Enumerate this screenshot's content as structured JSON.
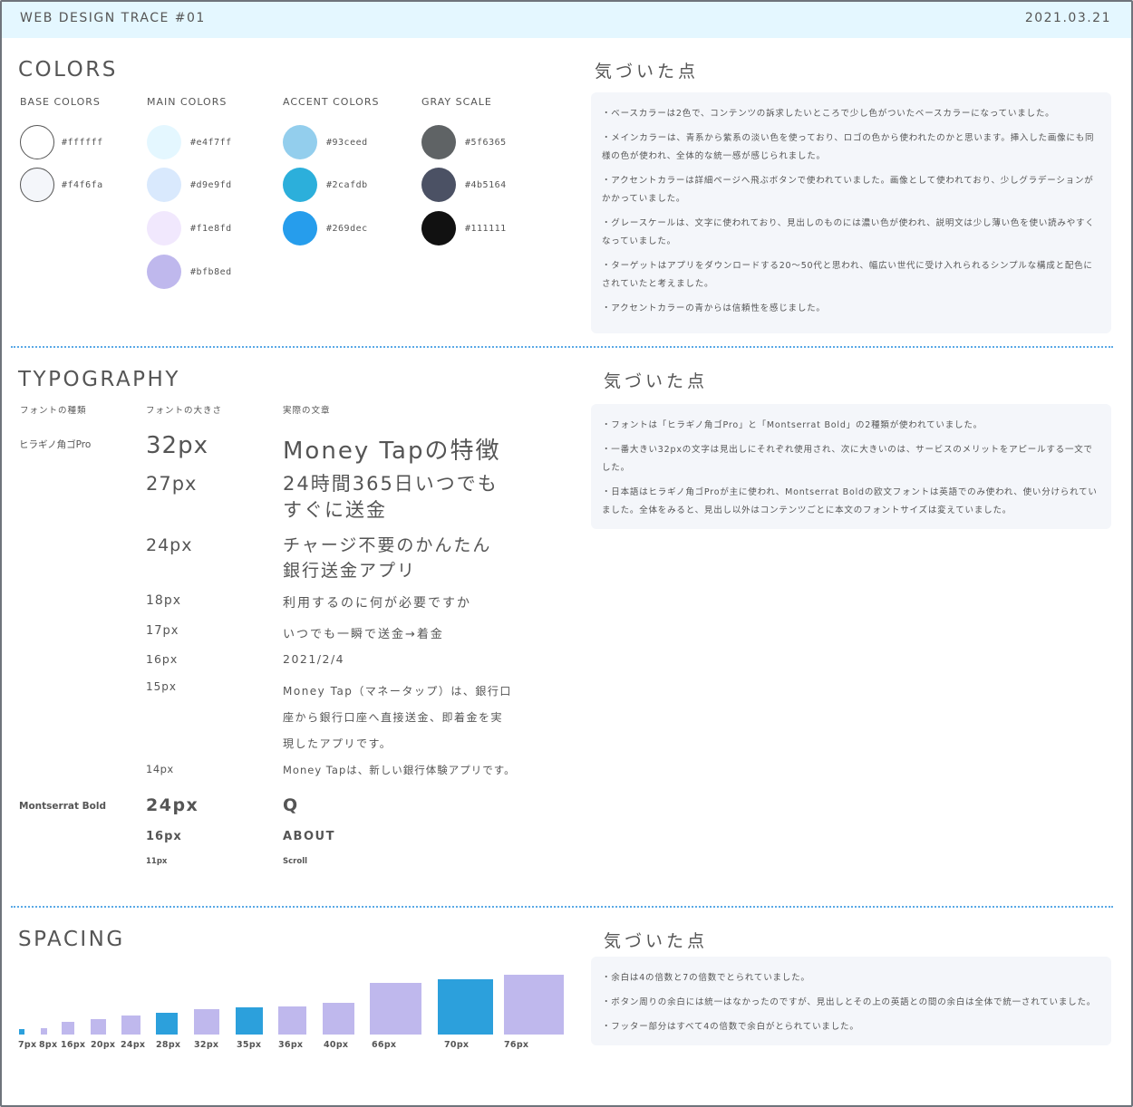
{
  "header": {
    "title": "WEB DESIGN TRACE #01",
    "date": "2021.03.21"
  },
  "colors": {
    "title": "COLORS",
    "groups": [
      {
        "label": "BASE COLORS",
        "items": [
          {
            "hex": "#ffffff"
          },
          {
            "hex": "#f4f6fa"
          }
        ]
      },
      {
        "label": "MAIN COLORS",
        "items": [
          {
            "hex": "#e4f7ff"
          },
          {
            "hex": "#d9e9fd"
          },
          {
            "hex": "#f1e8fd"
          },
          {
            "hex": "#bfb8ed"
          }
        ]
      },
      {
        "label": "ACCENT COLORS",
        "items": [
          {
            "hex": "#93ceed"
          },
          {
            "hex": "#2cafdb"
          },
          {
            "hex": "#269dec"
          }
        ]
      },
      {
        "label": "GRAY SCALE",
        "items": [
          {
            "hex": "#5f6365"
          },
          {
            "hex": "#4b5164"
          },
          {
            "hex": "#111111"
          }
        ]
      }
    ],
    "notes_title": "気づいた点",
    "notes": [
      "・ベースカラーは2色で、コンテンツの訴求したいところで少し色がついたベースカラーになっていました。",
      "・メインカラーは、青系から紫系の淡い色を使っており、ロゴの色から使われたのかと思います。挿入した画像にも同様の色が使われ、全体的な統一感が感じられました。",
      "・アクセントカラーは詳細ページへ飛ぶボタンで使われていました。画像として使われており、少しグラデーションがかかっていました。",
      "・グレースケールは、文字に使われており、見出しのものには濃い色が使われ、説明文は少し薄い色を使い読みやすくなっていました。",
      "・ターゲットはアプリをダウンロードする20〜50代と思われ、幅広い世代に受け入れられるシンプルな構成と配色にされていたと考えました。",
      "・アクセントカラーの青からは信頼性を感じました。"
    ]
  },
  "typography": {
    "title": "TYPOGRAPHY",
    "col_font": "フォントの種類",
    "col_size": "フォントの大きさ",
    "col_sample": "実際の文章",
    "font1": "ヒラギノ角ゴPro",
    "font2": "Montserrat Bold",
    "rows1": [
      {
        "size": "32px",
        "text": "Money Tapの特徴"
      },
      {
        "size": "27px",
        "text": "24時間365日いつでも\nすぐに送金"
      },
      {
        "size": "24px",
        "text": "チャージ不要のかんたん\n銀行送金アプリ"
      },
      {
        "size": "18px",
        "text": "利用するのに何が必要ですか"
      },
      {
        "size": "17px",
        "text": "いつでも一瞬で送金→着金"
      },
      {
        "size": "16px",
        "text": "2021/2/4"
      },
      {
        "size": "15px",
        "text": "Money Tap（マネータップ）は、銀行口\n座から銀行口座へ直接送金、即着金を実\n現したアプリです。"
      },
      {
        "size": "14px",
        "text": "Money Tapは、新しい銀行体験アプリです。"
      }
    ],
    "rows2": [
      {
        "size": "24px",
        "text": "Q"
      },
      {
        "size": "16px",
        "text": "ABOUT"
      },
      {
        "size": "11px",
        "text": "Scroll"
      }
    ],
    "notes_title": "気づいた点",
    "notes": [
      "・フォントは「ヒラギノ角ゴPro」と「Montserrat Bold」の2種類が使われていました。",
      "・一番大きい32pxの文字は見出しにそれぞれ使用され、次に大きいのは、サービスのメリットをアピールする一文でした。",
      "・日本語はヒラギノ角ゴProが主に使われ、Montserrat Boldの欧文フォントは英語でのみ使われ、使い分けられていました。全体をみると、見出し以外はコンテンツごとに本文のフォントサイズは変えていました。"
    ]
  },
  "spacing": {
    "title": "SPACING",
    "labels": [
      "7px",
      "8px",
      "16px",
      "20px",
      "24px",
      "28px",
      "32px",
      "35px",
      "36px",
      "40px",
      "66px",
      "70px",
      "76px"
    ],
    "values": [
      7,
      8,
      16,
      20,
      24,
      28,
      32,
      35,
      36,
      40,
      66,
      70,
      76
    ],
    "colors": [
      "#2ca0dc",
      "#bfb8ed",
      "#bfb8ed",
      "#bfb8ed",
      "#bfb8ed",
      "#2ca0dc",
      "#bfb8ed",
      "#2ca0dc",
      "#bfb8ed",
      "#bfb8ed",
      "#bfb8ed",
      "#2ca0dc",
      "#bfb8ed"
    ],
    "notes_title": "気づいた点",
    "notes": [
      "・余白は4の倍数と7の倍数でとられていました。",
      "・ボタン周りの余白には統一はなかったのですが、見出しとその上の英語との間の余白は全体で統一されていました。",
      "・フッター部分はすべて4の倍数で余白がとられていました。"
    ]
  }
}
